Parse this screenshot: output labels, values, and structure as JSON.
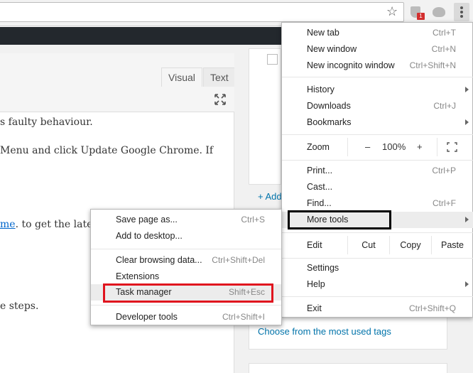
{
  "browser": {
    "extension_badge": "1",
    "icons": [
      "star-icon",
      "shield-extension-icon",
      "cloud-extension-icon",
      "more-vert-icon"
    ]
  },
  "editor": {
    "tabs": [
      "Visual",
      "Text"
    ],
    "lines": [
      "s faulty behaviour.",
      "Menu and click Update Google Chrome. If",
      "me",
      ". to get the late",
      "e steps."
    ]
  },
  "sidebar": {
    "add_link": "+ Add",
    "tags_link": "Choose from the most used tags"
  },
  "menu": {
    "items": [
      {
        "label": "New tab",
        "shortcut": "Ctrl+T"
      },
      {
        "label": "New window",
        "shortcut": "Ctrl+N"
      },
      {
        "label": "New incognito window",
        "shortcut": "Ctrl+Shift+N"
      },
      {
        "label": "History",
        "shortcut": ""
      },
      {
        "label": "Downloads",
        "shortcut": "Ctrl+J"
      },
      {
        "label": "Bookmarks",
        "shortcut": ""
      },
      {
        "label": "Print...",
        "shortcut": "Ctrl+P"
      },
      {
        "label": "Cast...",
        "shortcut": ""
      },
      {
        "label": "Find...",
        "shortcut": "Ctrl+F"
      },
      {
        "label": "More tools",
        "shortcut": ""
      },
      {
        "label": "Settings",
        "shortcut": ""
      },
      {
        "label": "Help",
        "shortcut": ""
      },
      {
        "label": "Exit",
        "shortcut": "Ctrl+Shift+Q"
      }
    ],
    "zoom": {
      "label": "Zoom",
      "minus": "–",
      "value": "100%",
      "plus": "+"
    },
    "edit": {
      "label": "Edit",
      "cut": "Cut",
      "copy": "Copy",
      "paste": "Paste"
    }
  },
  "submenu": {
    "items": [
      {
        "label": "Save page as...",
        "shortcut": "Ctrl+S"
      },
      {
        "label": "Add to desktop...",
        "shortcut": ""
      },
      {
        "label": "Clear browsing data...",
        "shortcut": "Ctrl+Shift+Del"
      },
      {
        "label": "Extensions",
        "shortcut": ""
      },
      {
        "label": "Task manager",
        "shortcut": "Shift+Esc"
      },
      {
        "label": "Developer tools",
        "shortcut": "Ctrl+Shift+I"
      }
    ]
  },
  "colors": {
    "highlight_red": "#e0141e",
    "highlight_black": "#000000",
    "link": "#0066cc",
    "admin_bar": "#23282d"
  }
}
